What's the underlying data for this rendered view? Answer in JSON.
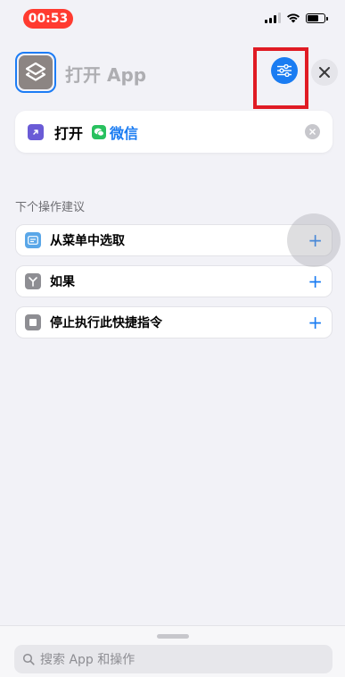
{
  "status_bar": {
    "time": "00:53"
  },
  "header": {
    "title": "打开 App"
  },
  "action_card": {
    "verb": "打开",
    "app_name": "微信"
  },
  "suggestions": {
    "header": "下个操作建议",
    "items": [
      {
        "label": "从菜单中选取",
        "icon": "menu-list-icon",
        "color": "#5aa7e8",
        "add": "+"
      },
      {
        "label": "如果",
        "icon": "if-branch-icon",
        "color": "#8e8e93",
        "add": "+"
      },
      {
        "label": "停止执行此快捷指令",
        "icon": "stop-icon",
        "color": "#8e8e93",
        "add": "+"
      }
    ]
  },
  "search": {
    "placeholder": "搜索 App 和操作"
  },
  "colors": {
    "accent": "#1a7cf2",
    "highlight": "#e01b24",
    "time_pill": "#ff3b30",
    "wechat": "#29c15f"
  }
}
